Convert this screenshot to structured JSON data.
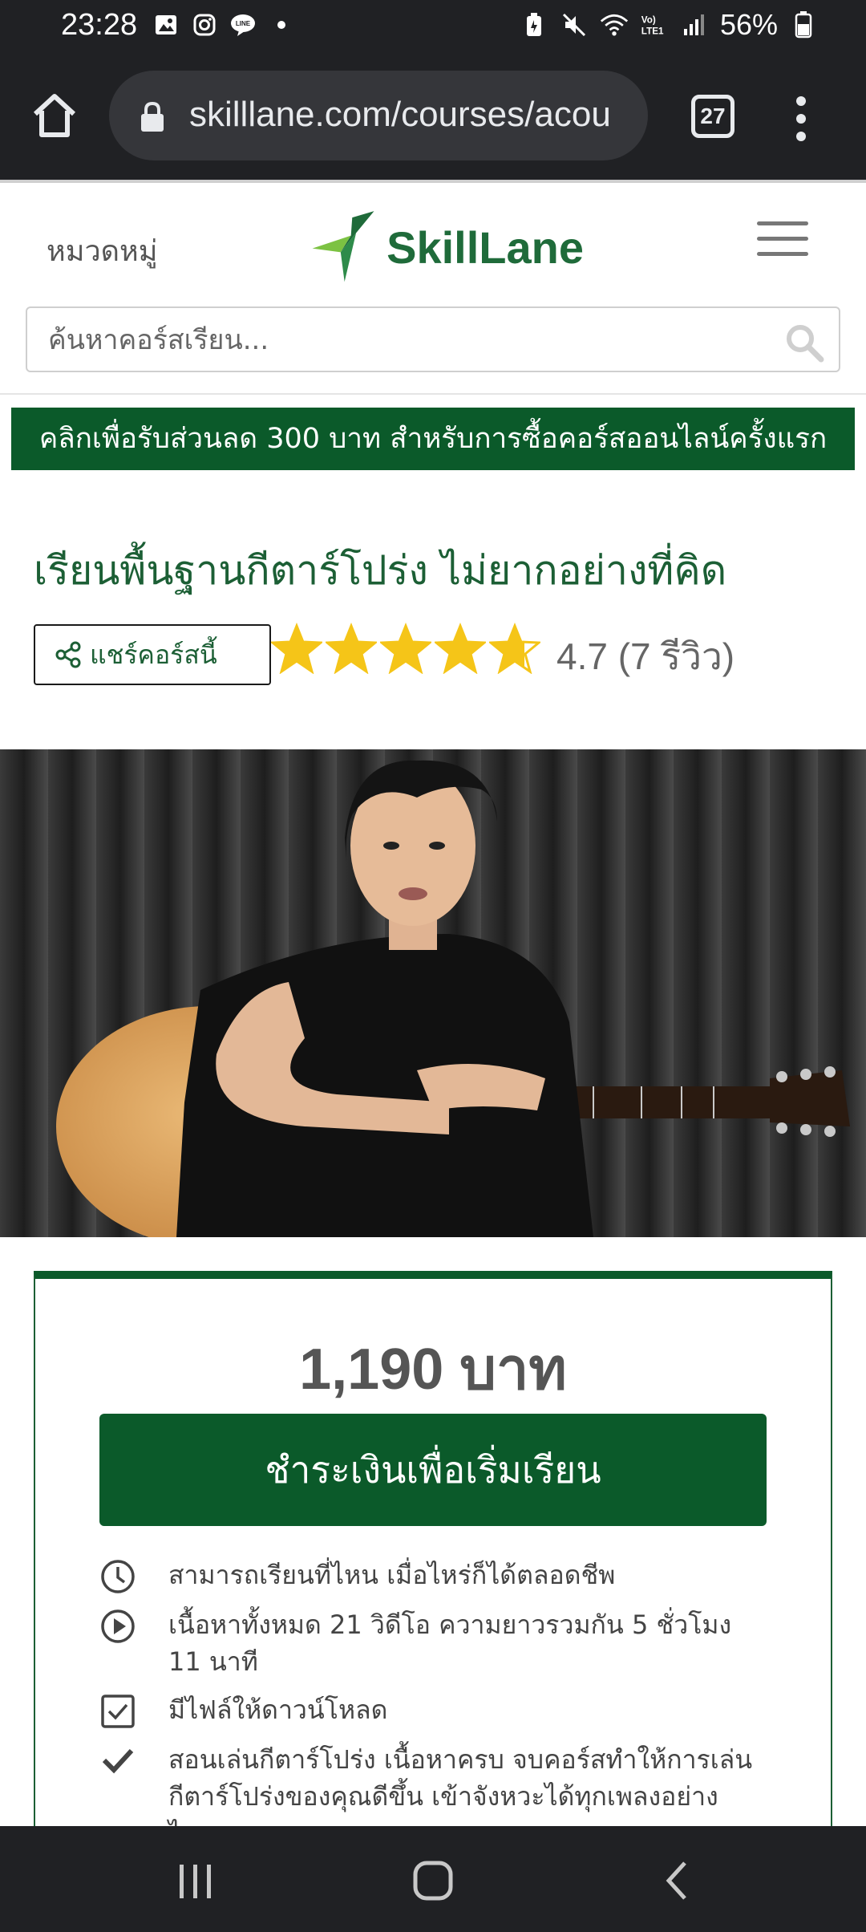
{
  "status_bar": {
    "time": "23:28",
    "battery": "56%",
    "left_icons": [
      "image-icon",
      "instagram-icon",
      "line-icon",
      "dot-icon"
    ],
    "right_icons": [
      "battery-saver-icon",
      "mute-icon",
      "wifi-icon",
      "lte-icon",
      "signal-icon",
      "battery-icon"
    ]
  },
  "browser": {
    "url": "skilllane.com/courses/acou",
    "tab_count": "27"
  },
  "header": {
    "category_label": "หมวดหมู่",
    "logo_text": "SkillLane",
    "search_placeholder": "ค้นหาคอร์สเรียน..."
  },
  "promo": {
    "text": "คลิกเพื่อรับส่วนลด 300 บาท สำหรับการซื้อคอร์สออนไลน์ครั้งแรก"
  },
  "course": {
    "title": "เรียนพื้นฐานกีตาร์โปร่ง ไม่ยากอย่างที่คิด",
    "share_label": "แชร์คอร์สนี้",
    "rating": 4.7,
    "rating_text": "4.7 (7 รีวิว)"
  },
  "card": {
    "price": "1,190 บาท",
    "pay_label": "ชำระเงินเพื่อเริ่มเรียน",
    "features": [
      {
        "icon": "clock-icon",
        "text": "สามารถเรียนที่ไหน เมื่อไหร่ก็ได้ตลอดชีพ"
      },
      {
        "icon": "play-icon",
        "text": "เนื้อหาทั้งหมด 21 วิดีโอ ความยาวรวมกัน 5 ชั่วโมง 11 นาที"
      },
      {
        "icon": "checkbox-icon",
        "text": "มีไฟล์ให้ดาวน์โหลด"
      },
      {
        "icon": "checkmark-icon",
        "text": "สอนเล่นกีตาร์โปร่ง เนื้อหาครบ จบคอร์สทำให้การเล่นกีตาร์โปร่งของคุณดีขึ้น เข้าจังหวะได้ทุกเพลงอย่างไพเราะ"
      }
    ]
  },
  "colors": {
    "brand_green": "#0b5a2a",
    "title_green": "#1c5f35",
    "star_yellow": "#f5c518"
  }
}
